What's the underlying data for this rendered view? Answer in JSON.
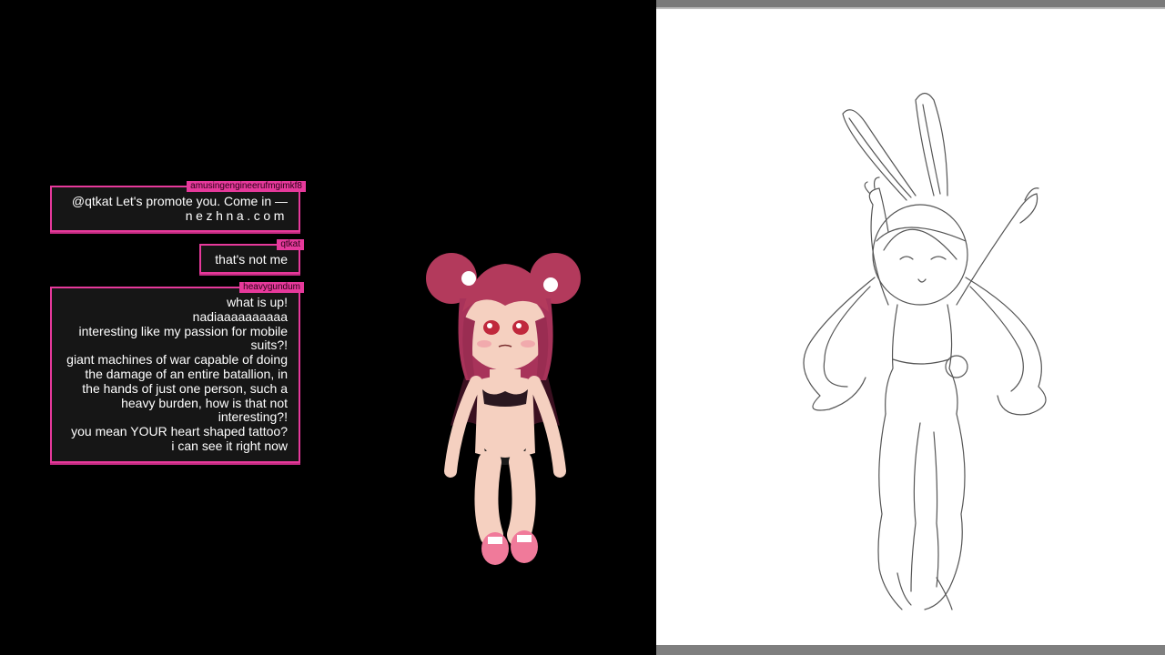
{
  "chat": {
    "messages": [
      {
        "username": "amusingengineerufmgimkf8",
        "lines": [
          "@qtkat Let's promote you. Come in —",
          "nezhna.com"
        ]
      },
      {
        "username": "qtkat",
        "lines": [
          "that's not me"
        ]
      },
      {
        "username": "heavygundum",
        "lines": [
          "what is up!",
          "nadiaaaaaaaaaa",
          "interesting like my passion for mobile",
          "suits?!",
          "giant machines of war capable of doing",
          "the damage of an entire batallion, in",
          "the hands of just one person, such a",
          "heavy burden, how is that not",
          "interesting?!",
          "you mean YOUR heart shaped tattoo?",
          "i can see it right now"
        ]
      }
    ]
  },
  "colors": {
    "accent": "#e6399b",
    "chat_bg": "#161616",
    "stream_bg": "#000000",
    "canvas_bg": "#ffffff",
    "canvas_frame": "#7a7a7a"
  },
  "icons": {
    "avatar": "vtuber-avatar-figure",
    "canvas_sketch": "pencil-sketch-figure"
  }
}
